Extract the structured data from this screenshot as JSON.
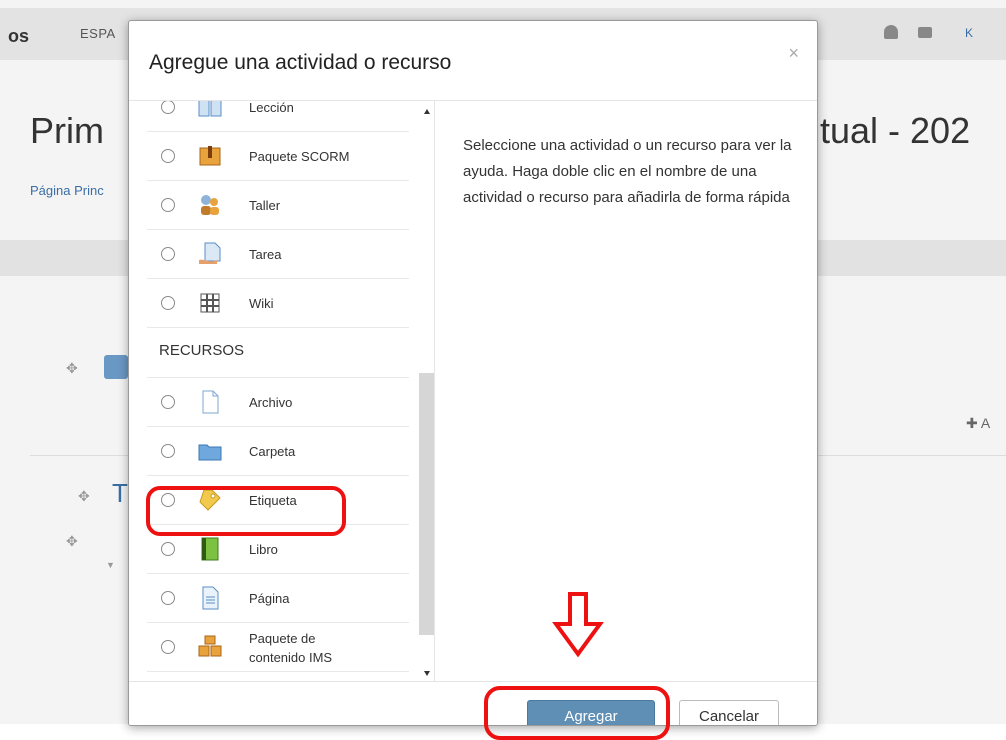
{
  "background": {
    "brand": "os",
    "language": "ESPA",
    "user": "K",
    "title_left": "Prim",
    "title_right": "tual - 202",
    "breadcrumb": "Página Princ",
    "add_label": "A",
    "section_letter": "T"
  },
  "modal": {
    "title": "Agregue una actividad o recurso",
    "close": "×",
    "help_text": "Seleccione una actividad o un recurso para ver la ayuda. Haga doble clic en el nombre de una actividad o recurso para añadirla de forma rápida",
    "activities": [
      {
        "label": "Lección",
        "icon": "lesson-icon"
      },
      {
        "label": "Paquete SCORM",
        "icon": "scorm-package-icon"
      },
      {
        "label": "Taller",
        "icon": "workshop-icon"
      },
      {
        "label": "Tarea",
        "icon": "assignment-icon"
      },
      {
        "label": "Wiki",
        "icon": "wiki-icon"
      }
    ],
    "resources_title": "RECURSOS",
    "resources": [
      {
        "label": "Archivo",
        "icon": "file-icon"
      },
      {
        "label": "Carpeta",
        "icon": "folder-icon"
      },
      {
        "label": "Etiqueta",
        "icon": "label-tag-icon"
      },
      {
        "label": "Libro",
        "icon": "book-icon"
      },
      {
        "label": "Página",
        "icon": "page-icon"
      },
      {
        "label": "Paquete de contenido IMS",
        "icon": "ims-package-icon"
      }
    ],
    "buttons": {
      "add": "Agregar",
      "cancel": "Cancelar"
    }
  },
  "colors": {
    "primary_button": "#5f8fb4",
    "annotation": "#e11111"
  }
}
